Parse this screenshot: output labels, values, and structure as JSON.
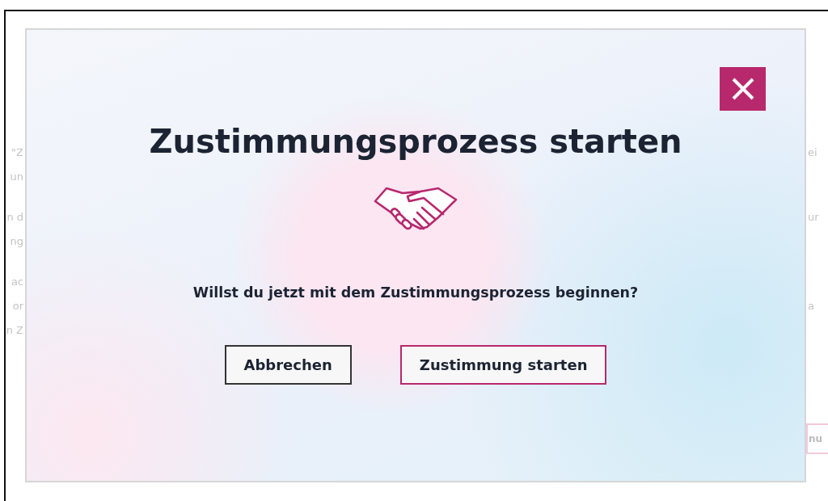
{
  "background": {
    "left_fragments": [
      "\"Z",
      "un",
      "n d",
      "ng",
      "ac",
      "or",
      "n Z"
    ],
    "right_fragments": [
      "ei",
      "ur",
      "a"
    ],
    "right_button": "nu"
  },
  "dialog": {
    "title": "Zustimmungsprozess starten",
    "question": "Willst du jetzt mit dem Zustimmungsprozess beginnen?",
    "buttons": [
      {
        "label": "Abbrechen",
        "kind": "secondary"
      },
      {
        "label": "Zustimmung starten",
        "kind": "primary"
      }
    ]
  }
}
